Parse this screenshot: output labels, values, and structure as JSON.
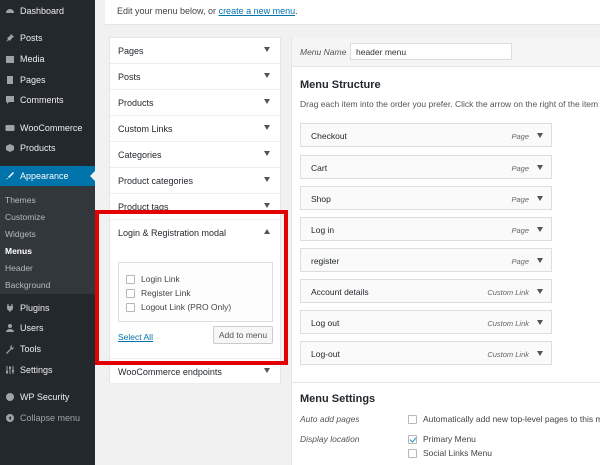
{
  "sidebar": {
    "items": [
      {
        "label": "Dashboard",
        "icon": "dashboard-icon"
      },
      {
        "label": "Posts",
        "icon": "pin-icon"
      },
      {
        "label": "Media",
        "icon": "media-icon"
      },
      {
        "label": "Pages",
        "icon": "pages-icon"
      },
      {
        "label": "Comments",
        "icon": "comment-icon"
      },
      {
        "label": "WooCommerce",
        "icon": "woocommerce-icon"
      },
      {
        "label": "Products",
        "icon": "box-icon"
      },
      {
        "label": "Appearance",
        "icon": "brush-icon"
      },
      {
        "label": "Plugins",
        "icon": "plug-icon"
      },
      {
        "label": "Users",
        "icon": "user-icon"
      },
      {
        "label": "Tools",
        "icon": "wrench-icon"
      },
      {
        "label": "Settings",
        "icon": "settings-icon"
      },
      {
        "label": "WP Security",
        "icon": "shield-icon"
      },
      {
        "label": "Collapse menu",
        "icon": "collapse-icon"
      }
    ],
    "appearance_submenu": [
      "Themes",
      "Customize",
      "Widgets",
      "Menus",
      "Header",
      "Background"
    ]
  },
  "intro": {
    "text": "Edit your menu below, or ",
    "link": "create a new menu",
    "end": "."
  },
  "accordion": {
    "sections": [
      "Pages",
      "Posts",
      "Products",
      "Custom Links",
      "Categories",
      "Product categories",
      "Product tags",
      "Login & Registration modal",
      "WooCommerce endpoints"
    ],
    "open_section": {
      "checkboxes": [
        "Login Link",
        "Register Link",
        "Logout Link (PRO Only)"
      ],
      "select_all": "Select All",
      "add_button": "Add to menu"
    }
  },
  "menu": {
    "name_label": "Menu Name",
    "name_value": "header menu",
    "structure_heading": "Menu Structure",
    "instructions": "Drag each item into the order you prefer. Click the arrow on the right of the item to re",
    "items": [
      {
        "title": "Checkout",
        "type": "Page"
      },
      {
        "title": "Cart",
        "type": "Page"
      },
      {
        "title": "Shop",
        "type": "Page"
      },
      {
        "title": "Log in",
        "type": "Page"
      },
      {
        "title": "register",
        "type": "Page"
      },
      {
        "title": "Account details",
        "type": "Custom Link"
      },
      {
        "title": "Log out",
        "type": "Custom Link"
      },
      {
        "title": "Log-out",
        "type": "Custom Link"
      }
    ],
    "settings_heading": "Menu Settings",
    "auto_add_label": "Auto add pages",
    "auto_add_text": "Automatically add new top-level pages to this menu",
    "display_location_label": "Display location",
    "locations": [
      {
        "name": "Primary Menu",
        "checked": true
      },
      {
        "name": "Social Links Menu",
        "checked": false
      }
    ]
  },
  "colors": {
    "sidebar_bg": "#23282d",
    "active": "#0073aa",
    "highlight": "#e30000"
  }
}
